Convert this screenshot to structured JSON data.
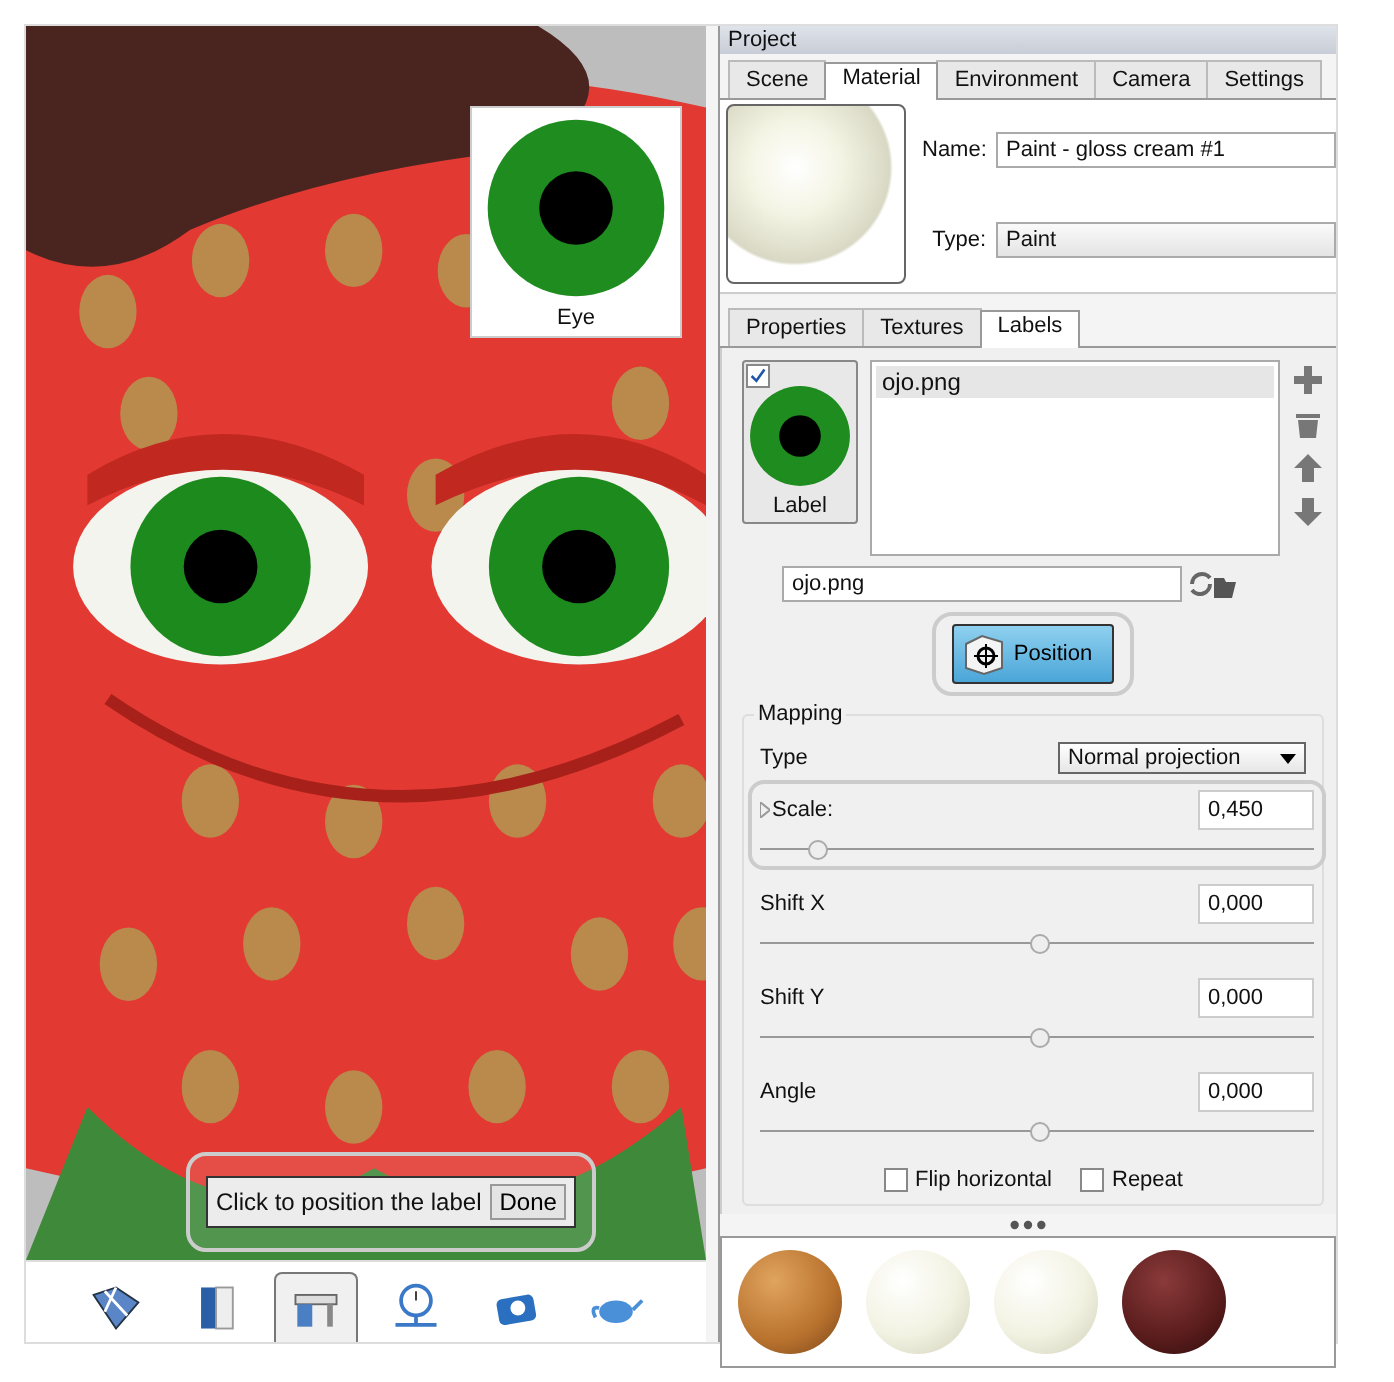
{
  "window": {
    "title": "Project"
  },
  "viewport": {
    "label_preview": {
      "caption": "Eye"
    },
    "hint": {
      "text": "Click to position the label",
      "button": "Done"
    },
    "toolbar": [
      {
        "kind": "surface",
        "selected": false
      },
      {
        "kind": "book",
        "selected": false
      },
      {
        "kind": "desk",
        "selected": true
      },
      {
        "kind": "timer",
        "selected": false
      },
      {
        "kind": "camera",
        "selected": false
      },
      {
        "kind": "teapot",
        "selected": false
      }
    ]
  },
  "tabs": [
    {
      "label": "Scene",
      "selected": false
    },
    {
      "label": "Material",
      "selected": true
    },
    {
      "label": "Environment",
      "selected": false
    },
    {
      "label": "Camera",
      "selected": false
    },
    {
      "label": "Settings",
      "selected": false
    }
  ],
  "material": {
    "name_label": "Name:",
    "name": "Paint - gloss cream #1",
    "type_label": "Type:",
    "type": "Paint"
  },
  "subtabs": [
    {
      "label": "Properties",
      "selected": false
    },
    {
      "label": "Textures",
      "selected": false
    },
    {
      "label": "Labels",
      "selected": true
    }
  ],
  "labels": {
    "thumb_caption": "Label",
    "checked": true,
    "items": [
      {
        "text": "ojo.png",
        "selected": true
      }
    ],
    "file": "ojo.png"
  },
  "position_button": {
    "label": "Position",
    "highlighted": true
  },
  "mapping": {
    "title": "Mapping",
    "type_label": "Type",
    "type": "Normal projection",
    "params": [
      {
        "label": "Scale:",
        "value": "0,450",
        "level": 0.1,
        "highlighted": true,
        "expandable": true
      },
      {
        "label": "Shift X",
        "value": "0,000",
        "level": 0.5,
        "highlighted": false,
        "expandable": false
      },
      {
        "label": "Shift Y",
        "value": "0,000",
        "level": 0.5,
        "highlighted": false,
        "expandable": false
      },
      {
        "label": "Angle",
        "value": "0,000",
        "level": 0.5,
        "highlighted": false,
        "expandable": false
      }
    ],
    "options": [
      {
        "label": "Flip horizontal",
        "checked": false
      },
      {
        "label": "Repeat",
        "checked": false
      }
    ]
  },
  "swatches": [
    {
      "kind": "wood"
    },
    {
      "kind": "cream"
    },
    {
      "kind": "cream"
    },
    {
      "kind": "chocolate"
    }
  ]
}
